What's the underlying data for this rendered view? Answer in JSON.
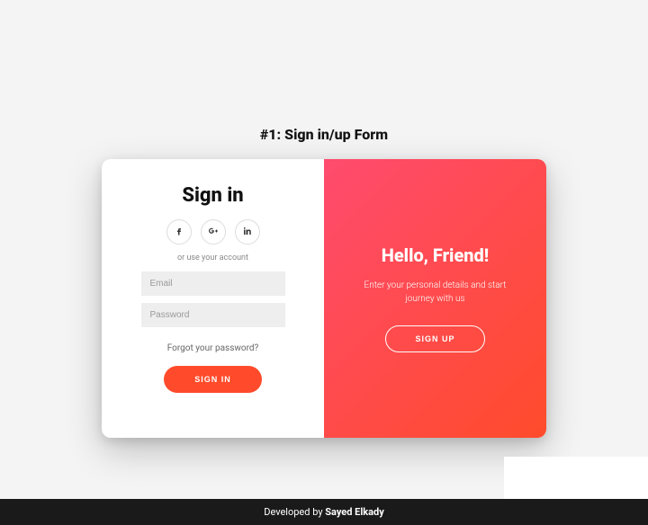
{
  "page": {
    "title": "#1: Sign in/up Form"
  },
  "form": {
    "title": "Sign in",
    "hint": "or use your account",
    "email_placeholder": "Email",
    "password_placeholder": "Password",
    "forgot": "Forgot your password?",
    "submit": "Sign In"
  },
  "social": {
    "facebook": "facebook-icon",
    "google": "google-plus-icon",
    "linkedin": "linkedin-icon"
  },
  "overlay": {
    "title": "Hello, Friend!",
    "text": "Enter your personal details and start journey with us",
    "button": "Sign Up"
  },
  "footer": {
    "prefix": "Developed by ",
    "author": "Sayed Elkady"
  }
}
